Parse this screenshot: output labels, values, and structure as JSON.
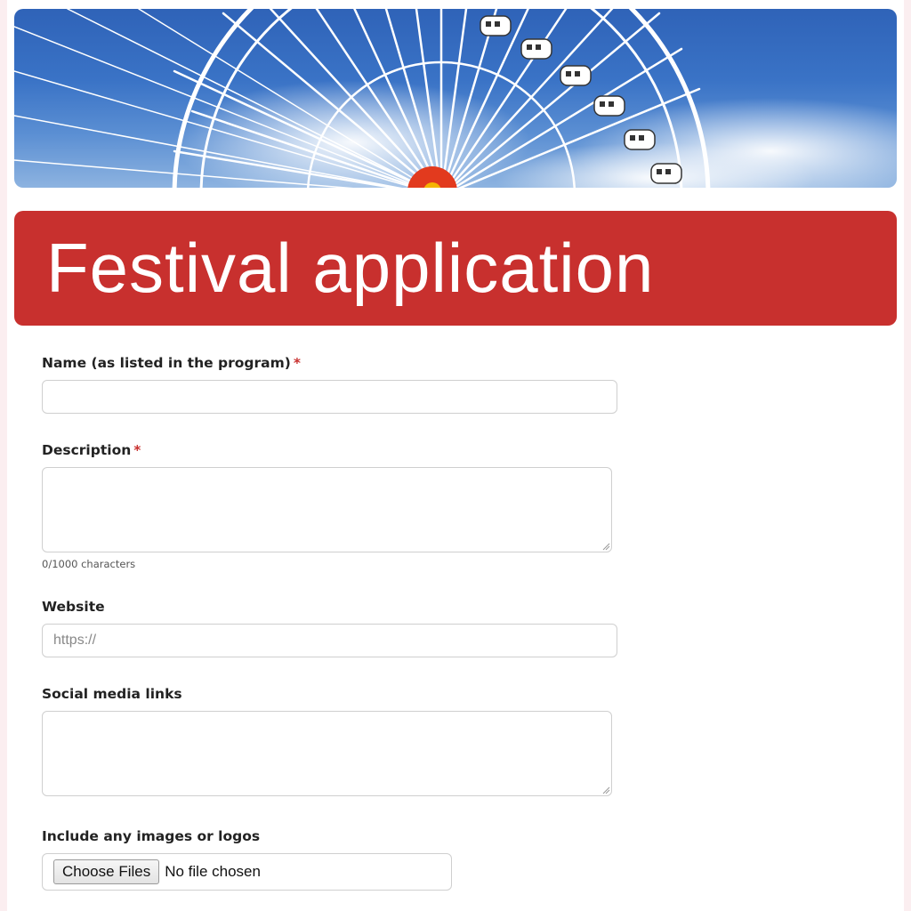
{
  "form": {
    "title": "Festival application",
    "fields": {
      "name": {
        "label": "Name (as listed in the program)",
        "required_mark": "*",
        "value": ""
      },
      "description": {
        "label": "Description",
        "required_mark": "*",
        "value": "",
        "counter": "0/1000 characters"
      },
      "website": {
        "label": "Website",
        "placeholder": "https://",
        "value": ""
      },
      "social": {
        "label": "Social media links",
        "value": ""
      },
      "images": {
        "label": "Include any images or logos",
        "button_label": "Choose Files",
        "status": "No file chosen"
      }
    }
  },
  "colors": {
    "accent": "#c8302e",
    "page_bg": "#fbeef0",
    "sky": "#3a73c6"
  },
  "icons": {
    "banner": "ferris-wheel-image",
    "resize": "resize-grip-icon"
  }
}
